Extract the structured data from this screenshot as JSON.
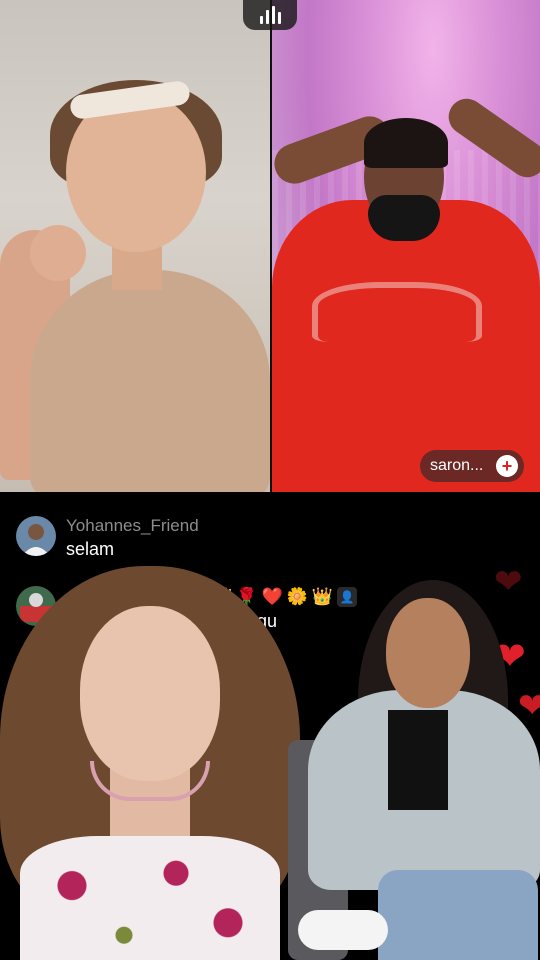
{
  "stage": {
    "right_participant": {
      "name_label": "saron...",
      "add_icon": "plus-circle-icon"
    },
    "audio_icon": "audio-bars-icon"
  },
  "comments": [
    {
      "username": "Yohannes_Friend",
      "message": "selam"
    },
    {
      "username": "",
      "message": "adergu",
      "badges": [
        "🎁",
        "👑",
        "🌹",
        "❤️",
        "🌼",
        "👑",
        "👤"
      ]
    }
  ],
  "hearts": [
    "heart-icon",
    "heart-icon",
    "heart-icon"
  ],
  "colors": {
    "heart": "#e0202a",
    "username": "#8d8d8d",
    "chip_bg": "#4a2a2a"
  }
}
